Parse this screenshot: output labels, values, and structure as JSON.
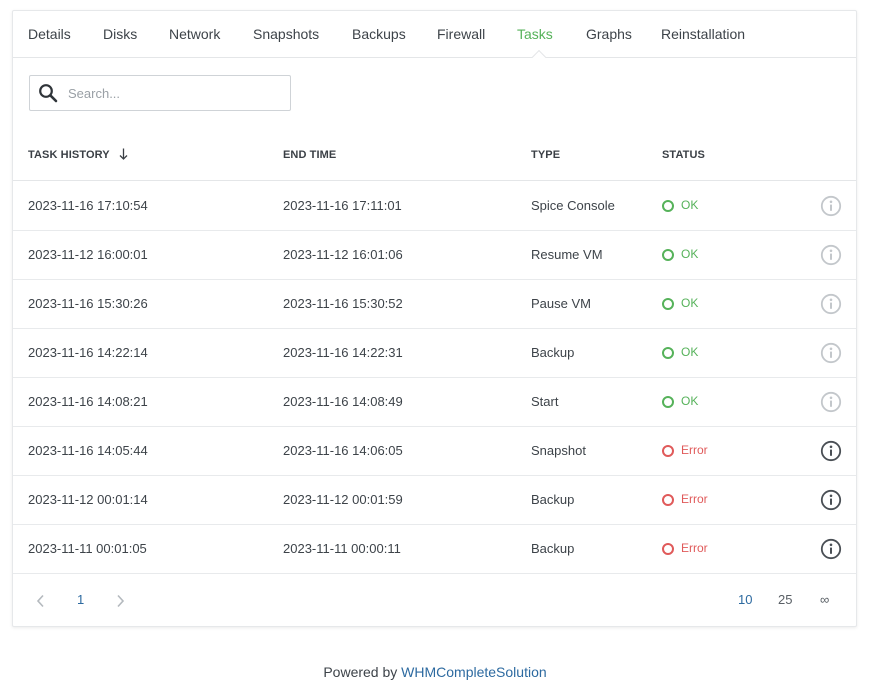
{
  "tabs": [
    {
      "label": "Details"
    },
    {
      "label": "Disks"
    },
    {
      "label": "Network"
    },
    {
      "label": "Snapshots"
    },
    {
      "label": "Backups"
    },
    {
      "label": "Firewall"
    },
    {
      "label": "Tasks",
      "active": true
    },
    {
      "label": "Graphs"
    },
    {
      "label": "Reinstallation"
    }
  ],
  "search": {
    "placeholder": "Search...",
    "value": ""
  },
  "table": {
    "columns": {
      "task_history": "TASK HISTORY",
      "end_time": "END TIME",
      "type": "TYPE",
      "status": "STATUS"
    },
    "sort_icon": "arrow-down-icon",
    "rows": [
      {
        "task_history": "2023-11-16 17:10:54",
        "end_time": "2023-11-16 17:11:01",
        "type": "Spice Console",
        "status": "OK",
        "status_kind": "ok"
      },
      {
        "task_history": "2023-11-12 16:00:01",
        "end_time": "2023-11-12 16:01:06",
        "type": "Resume VM",
        "status": "OK",
        "status_kind": "ok"
      },
      {
        "task_history": "2023-11-16 15:30:26",
        "end_time": "2023-11-16 15:30:52",
        "type": "Pause VM",
        "status": "OK",
        "status_kind": "ok"
      },
      {
        "task_history": "2023-11-16 14:22:14",
        "end_time": "2023-11-16 14:22:31",
        "type": "Backup",
        "status": "OK",
        "status_kind": "ok"
      },
      {
        "task_history": "2023-11-16 14:08:21",
        "end_time": "2023-11-16 14:08:49",
        "type": "Start",
        "status": "OK",
        "status_kind": "ok"
      },
      {
        "task_history": "2023-11-16 14:05:44",
        "end_time": "2023-11-16 14:06:05",
        "type": "Snapshot",
        "status": "Error",
        "status_kind": "error"
      },
      {
        "task_history": "2023-11-12 00:01:14",
        "end_time": "2023-11-12 00:01:59",
        "type": "Backup",
        "status": "Error",
        "status_kind": "error"
      },
      {
        "task_history": "2023-11-11 00:01:05",
        "end_time": "2023-11-11 00:00:11",
        "type": "Backup",
        "status": "Error",
        "status_kind": "error"
      }
    ]
  },
  "pagination": {
    "current_page": "1",
    "page_sizes": [
      "10",
      "25",
      "∞"
    ],
    "selected_page_size": "10"
  },
  "footer": {
    "prefix": "Powered by",
    "link_text": "WHMCompleteSolution"
  },
  "colors": {
    "accent": "#56b25a",
    "error": "#e05a5a",
    "link": "#2d6aa0"
  }
}
